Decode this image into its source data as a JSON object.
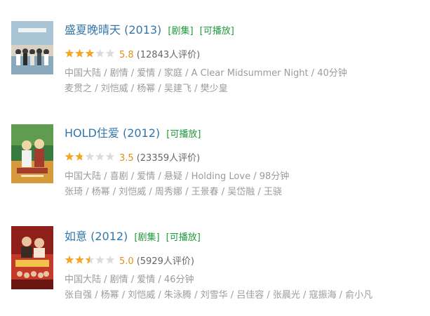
{
  "items": [
    {
      "title": "盛夏晚晴天 (2013)",
      "tags": [
        "[剧集]",
        "[可播放]"
      ],
      "rating": 5.8,
      "score": "5.8",
      "count": "(12843人评价)",
      "meta": "中国大陆 / 剧情 / 爱情 / 家庭 / A Clear Midsummer Night / 40分钟",
      "cast": "麦贯之 / 刘恺威 / 杨幂 / 吴建飞 / 樊少皇",
      "poster_colors": [
        "#cfe0ea",
        "#8aa9bd",
        "#d9d2c4",
        "#6b6f72"
      ]
    },
    {
      "title": "HOLD住爱 (2012)",
      "tags": [
        "[可播放]"
      ],
      "rating": 3.5,
      "score": "3.5",
      "count": "(23359人评价)",
      "meta": "中国大陆 / 喜剧 / 爱情 / 悬疑 / Holding Love / 98分钟",
      "cast": "张琦 / 杨幂 / 刘恺威 / 周秀娜 / 王景春 / 吴岱融 / 王骁",
      "poster_colors": [
        "#3a7a3f",
        "#d79a3a",
        "#a43b2e",
        "#efd6a8"
      ]
    },
    {
      "title": "如意 (2012)",
      "tags": [
        "[剧集]",
        "[可播放]"
      ],
      "rating": 5.0,
      "score": "5.0",
      "count": "(5929人评价)",
      "meta": "中国大陆 / 剧情 / 爱情 / 46分钟",
      "cast": "张自强 / 杨幂 / 刘恺威 / 朱泳腾 / 刘雪华 / 吕佳容 / 张晨光 / 寇振海 / 俞小凡",
      "poster_colors": [
        "#c43a2a",
        "#8e1f1a",
        "#e8c4a0",
        "#3a2a24"
      ]
    }
  ],
  "star_color": "#f5a623",
  "star_empty_color": "#dcdcdc"
}
